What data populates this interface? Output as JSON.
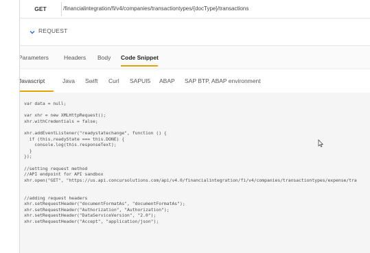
{
  "endpoint": {
    "method": "GET",
    "path": "/financialintegration/fi/v4/companies/transactiontypes/{docType}/transactions"
  },
  "request": {
    "label": "REQUEST"
  },
  "tabs_primary": [
    "Parameters",
    "Headers",
    "Body",
    "Code Snippet"
  ],
  "tabs_secondary": [
    "Javascript",
    "Java",
    "Swift",
    "Curl",
    "SAPUI5",
    "ABAP",
    "SAP BTP, ABAP environment"
  ],
  "colors": {
    "accent": "#e8a200",
    "chevron": "#2a6bd6"
  },
  "code_lines": [
    "var data = null;",
    "",
    "var xhr = new XMLHttpRequest();",
    "xhr.withCredentials = false;",
    "",
    "xhr.addEventListener(\"readystatechange\", function () {",
    "  if (this.readyState === this.DONE) {",
    "    console.log(this.responseText);",
    "  }",
    "});",
    "",
    "//setting request method",
    "//API endpoint for API sandbox",
    "xhr.open(\"GET\", \"https://us.api.concursolutions.com/api/v4.0/financialintegration/fi/v4/companies/transactiontypes/expense/tra",
    "",
    "",
    "//adding request headers",
    "xhr.setRequestHeader(\"documentFormatAs\", \"documentFormatAs\");",
    "xhr.setRequestHeader(\"Authorization\", \"Authorization\");",
    "xhr.setRequestHeader(\"DataServiceVersion\", \"2.0\");",
    "xhr.setRequestHeader(\"Accept\", \"application/json\");"
  ]
}
